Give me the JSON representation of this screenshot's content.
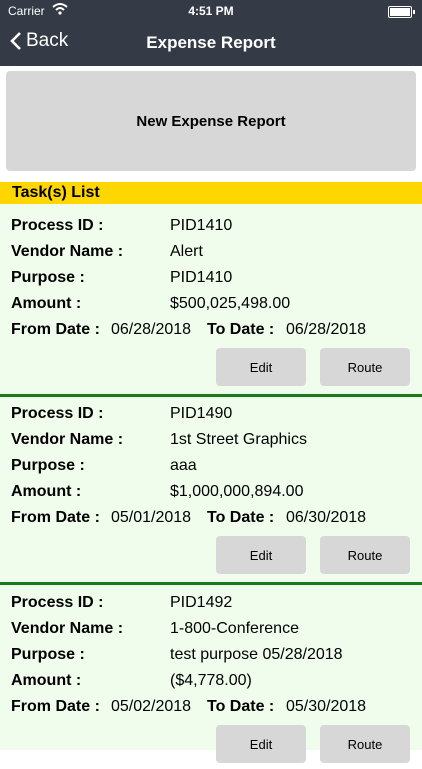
{
  "status": {
    "carrier": "Carrier",
    "time": "4:51 PM"
  },
  "nav": {
    "back_label": "Back",
    "title": "Expense Report"
  },
  "new_report_label": "New Expense Report",
  "tasks_title": "Task(s) List",
  "labels": {
    "process_id": "Process ID :",
    "vendor": "Vendor Name :",
    "purpose": "Purpose :",
    "amount": "Amount :",
    "from_date": "From Date :",
    "to_date": "To Date :",
    "edit": "Edit",
    "route": "Route"
  },
  "tasks": [
    {
      "process_id": "PID1410",
      "vendor": "Alert",
      "purpose": "PID1410",
      "amount": "$500,025,498.00",
      "from": "06/28/2018",
      "to": "06/28/2018"
    },
    {
      "process_id": "PID1490",
      "vendor": "1st Street Graphics",
      "purpose": "aaa",
      "amount": "$1,000,000,894.00",
      "from": "05/01/2018",
      "to": "06/30/2018"
    },
    {
      "process_id": "PID1492",
      "vendor": "1-800-Conference",
      "purpose": "test purpose 05/28/2018",
      "amount": "($4,778.00)",
      "from": "05/02/2018",
      "to": "05/30/2018"
    }
  ],
  "colors": {
    "header": "#343a46",
    "tasks_bar": "#ffd600",
    "list_bg": "#f0fdec",
    "separator": "#1a7a1a",
    "button": "#d7d7d7"
  }
}
